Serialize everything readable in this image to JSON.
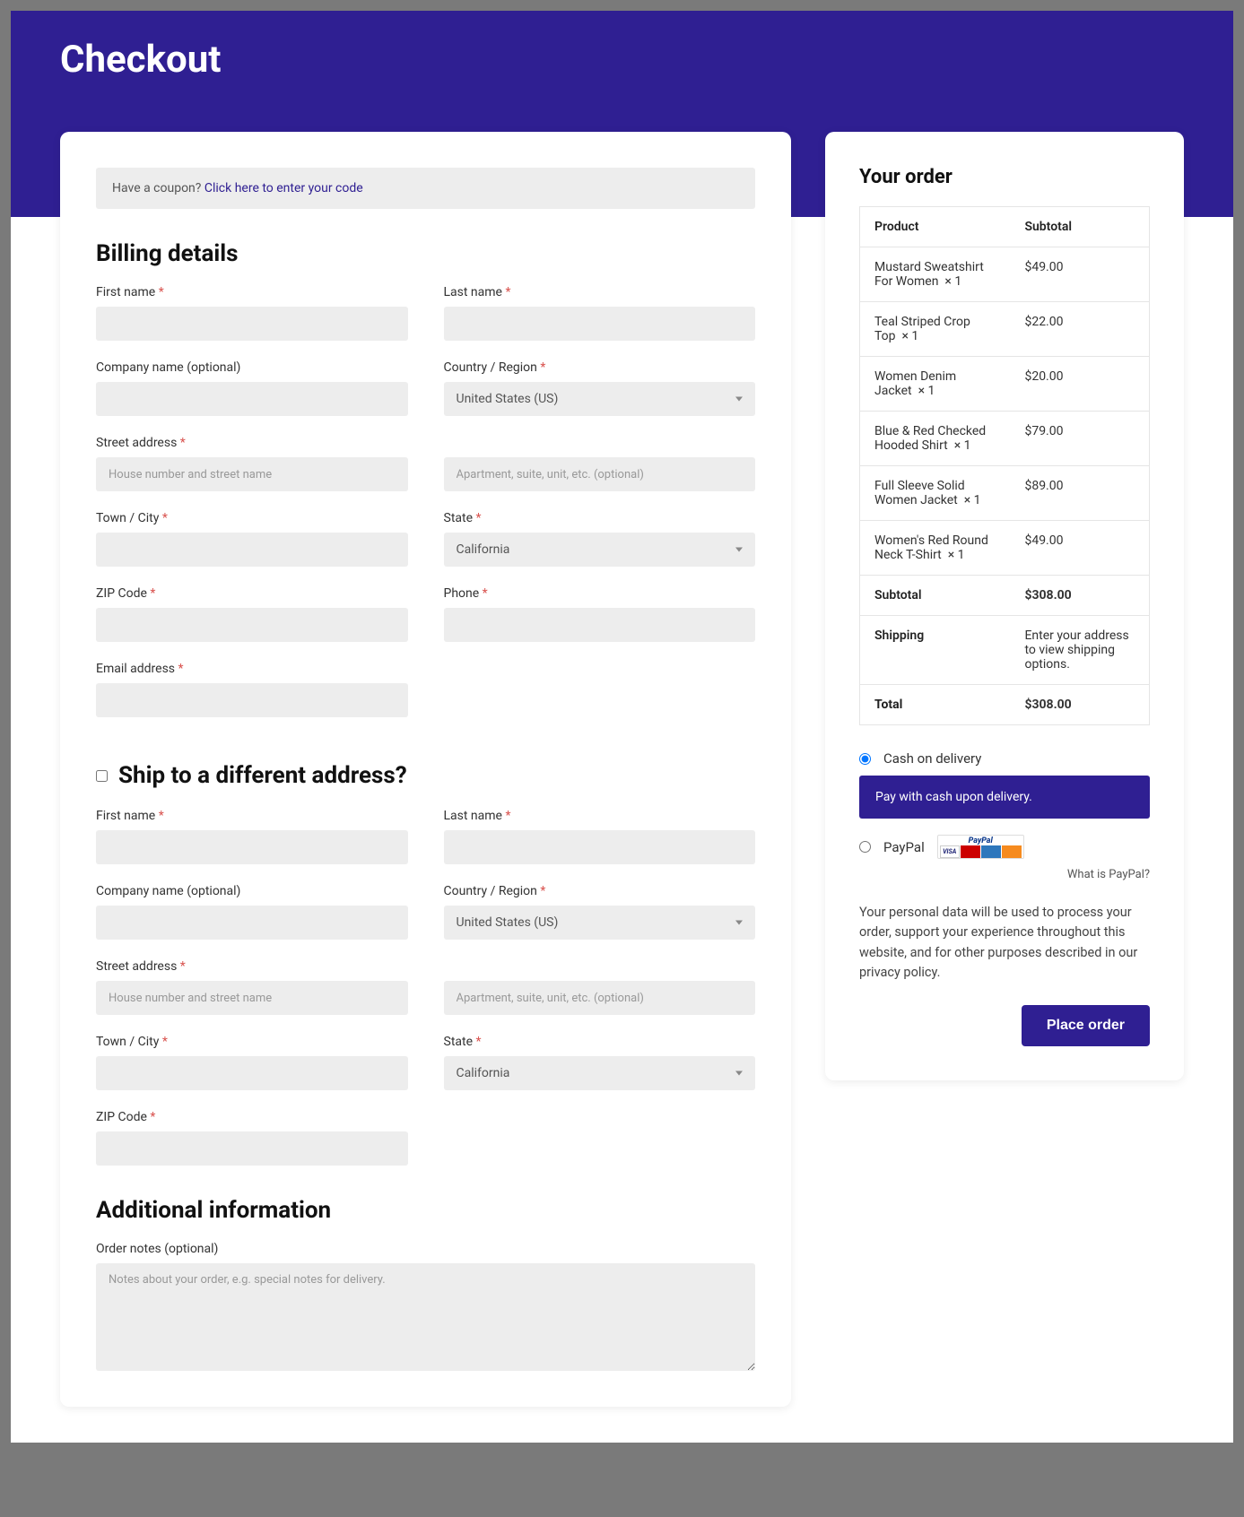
{
  "page": {
    "title": "Checkout"
  },
  "coupon": {
    "prompt": "Have a coupon? ",
    "link": "Click here to enter your code"
  },
  "billing": {
    "heading": "Billing details",
    "first_name": "First name",
    "last_name": "Last name",
    "company": "Company name (optional)",
    "country": "Country / Region",
    "country_value": "United States (US)",
    "street": "Street address",
    "street_ph": "House number and street name",
    "street2_ph": "Apartment, suite, unit, etc. (optional)",
    "city": "Town / City",
    "state": "State",
    "state_value": "California",
    "zip": "ZIP Code",
    "phone": "Phone",
    "email": "Email address"
  },
  "shipping": {
    "heading": "Ship to a different address?",
    "first_name": "First name",
    "last_name": "Last name",
    "company": "Company name (optional)",
    "country": "Country / Region",
    "country_value": "United States (US)",
    "street": "Street address",
    "street_ph": "House number and street name",
    "street2_ph": "Apartment, suite, unit, etc. (optional)",
    "city": "Town / City",
    "state": "State",
    "state_value": "California",
    "zip": "ZIP Code"
  },
  "additional": {
    "heading": "Additional information",
    "notes_label": "Order notes (optional)",
    "notes_ph": "Notes about your order, e.g. special notes for delivery."
  },
  "order": {
    "heading": "Your order",
    "col_product": "Product",
    "col_subtotal": "Subtotal",
    "items": [
      {
        "name": "Mustard Sweatshirt For Women",
        "qty": "× 1",
        "price": "$49.00"
      },
      {
        "name": "Teal Striped Crop Top",
        "qty": "× 1",
        "price": "$22.00"
      },
      {
        "name": "Women Denim Jacket",
        "qty": "× 1",
        "price": "$20.00"
      },
      {
        "name": "Blue & Red Checked Hooded Shirt",
        "qty": "× 1",
        "price": "$79.00"
      },
      {
        "name": "Full Sleeve Solid Women Jacket",
        "qty": "× 1",
        "price": "$89.00"
      },
      {
        "name": "Women's Red Round Neck T-Shirt",
        "qty": "× 1",
        "price": "$49.00"
      }
    ],
    "subtotal_label": "Subtotal",
    "subtotal_value": "$308.00",
    "shipping_label": "Shipping",
    "shipping_value": "Enter your address to view shipping options.",
    "total_label": "Total",
    "total_value": "$308.00"
  },
  "payment": {
    "cod_label": "Cash on delivery",
    "cod_desc": "Pay with cash upon delivery.",
    "paypal_label": "PayPal",
    "paypal_brand": "PayPal",
    "what_is": "What is PayPal?",
    "privacy": "Your personal data will be used to process your order, support your experience throughout this website, and for other purposes described in our privacy policy.",
    "place": "Place order"
  }
}
